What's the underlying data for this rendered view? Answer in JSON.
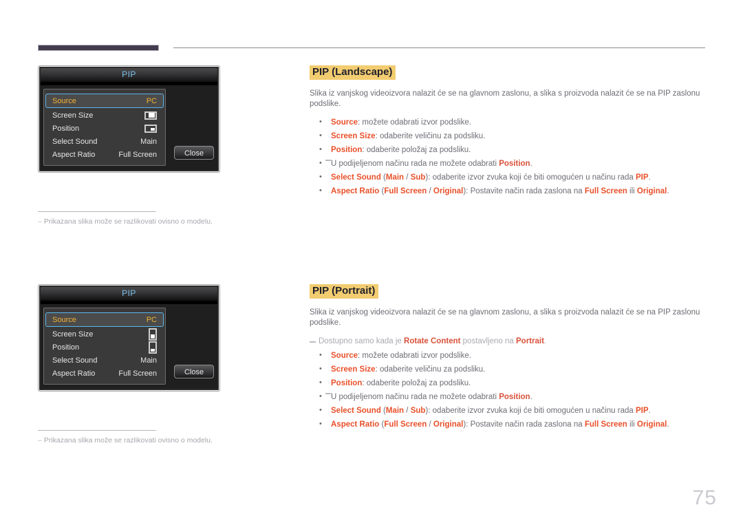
{
  "page": {
    "number": "75"
  },
  "sections": [
    {
      "id": "landscape",
      "heading": "PIP (Landscape)",
      "intro": "Slika iz vanjskog videoizvora nalazit će se na glavnom zaslonu, a slika s proizvoda nalazit će se na PIP zaslonu podslike.",
      "figure": {
        "title": "PIP",
        "close_label": "Close",
        "rows": [
          {
            "label": "Source",
            "value": "PC",
            "type": "text",
            "selected": true
          },
          {
            "label": "Screen Size",
            "value": "",
            "type": "icon-size-landscape",
            "icon_name": "screen-size-landscape-icon",
            "selected": false
          },
          {
            "label": "Position",
            "value": "",
            "type": "icon-position-landscape",
            "icon_name": "position-landscape-icon",
            "selected": false
          },
          {
            "label": "Select Sound",
            "value": "Main",
            "type": "text",
            "selected": false
          },
          {
            "label": "Aspect Ratio",
            "value": "Full Screen",
            "type": "text",
            "selected": false
          }
        ]
      },
      "figure_note": "Prikazana slika može se razlikovati ovisno o modelu.",
      "items": [
        {
          "kind": "bullet",
          "term": "Source",
          "rest": ": možete odabrati izvor podslike."
        },
        {
          "kind": "bullet",
          "term": "Screen Size",
          "rest": ": odaberite veličinu za podsliku."
        },
        {
          "kind": "bullet",
          "term": "Position",
          "rest": ": odaberite položaj za podsliku."
        },
        {
          "kind": "note",
          "pre": "U podijeljenom načinu rada ne možete odabrati ",
          "term": "Position",
          "post": "."
        },
        {
          "kind": "bullet-complex",
          "term": "Select Sound",
          "paren_open": " (",
          "paren_terms": [
            "Main",
            "Sub"
          ],
          "paren_sep": " / ",
          "paren_close": ")",
          "rest": ": odaberite izvor zvuka koji će biti omogućen u načinu rada ",
          "tail_term": "PIP",
          "tail": "."
        },
        {
          "kind": "bullet-complex",
          "term": "Aspect Ratio",
          "paren_open": " (",
          "paren_terms": [
            "Full Screen",
            "Original"
          ],
          "paren_sep": " / ",
          "paren_close": ")",
          "rest": ": Postavite način rada zaslona na ",
          "tail_term": "Full Screen",
          "tail_mid": " ili ",
          "tail_term2": "Original",
          "tail": "."
        }
      ]
    },
    {
      "id": "portrait",
      "heading": "PIP (Portrait)",
      "intro": "Slika iz vanjskog videoizvora nalazit će se na glavnom zaslonu, a slika s proizvoda nalazit će se na PIP zaslonu podslike.",
      "lead_note": {
        "pre": "Dostupno samo kada je ",
        "term": "Rotate Content",
        "mid": " postavljeno na ",
        "term2": "Portrait",
        "post": "."
      },
      "figure": {
        "title": "PIP",
        "close_label": "Close",
        "rows": [
          {
            "label": "Source",
            "value": "PC",
            "type": "text",
            "selected": true
          },
          {
            "label": "Screen Size",
            "value": "",
            "type": "icon-size-portrait",
            "icon_name": "screen-size-portrait-icon",
            "selected": false
          },
          {
            "label": "Position",
            "value": "",
            "type": "icon-position-portrait",
            "icon_name": "position-portrait-icon",
            "selected": false
          },
          {
            "label": "Select Sound",
            "value": "Main",
            "type": "text",
            "selected": false
          },
          {
            "label": "Aspect Ratio",
            "value": "Full Screen",
            "type": "text",
            "selected": false
          }
        ]
      },
      "figure_note": "Prikazana slika može se razlikovati ovisno o modelu.",
      "items": [
        {
          "kind": "bullet",
          "term": "Source",
          "rest": ": možete odabrati izvor podslike."
        },
        {
          "kind": "bullet",
          "term": "Screen Size",
          "rest": ": odaberite veličinu za podsliku."
        },
        {
          "kind": "bullet",
          "term": "Position",
          "rest": ": odaberite položaj za podsliku."
        },
        {
          "kind": "note",
          "pre": "U podijeljenom načinu rada ne možete odabrati ",
          "term": "Position",
          "post": "."
        },
        {
          "kind": "bullet-complex",
          "term": "Select Sound",
          "paren_open": " (",
          "paren_terms": [
            "Main",
            "Sub"
          ],
          "paren_sep": " / ",
          "paren_close": ")",
          "rest": ": odaberite izvor zvuka koji će biti omogućen u načinu rada ",
          "tail_term": "PIP",
          "tail": "."
        },
        {
          "kind": "bullet-complex",
          "term": "Aspect Ratio",
          "paren_open": " (",
          "paren_terms": [
            "Full Screen",
            "Original"
          ],
          "paren_sep": " / ",
          "paren_close": ")",
          "rest": ": Postavite način rada zaslona na ",
          "tail_term": "Full Screen",
          "tail_mid": " ili ",
          "tail_term2": "Original",
          "tail": "."
        }
      ]
    }
  ],
  "colors": {
    "heading_highlight": "#f2cc70",
    "keyword": "#e8502a",
    "body_text": "#6d6d75",
    "note_text": "#a9a9b1",
    "osd_title": "#7ec2ef",
    "osd_selected_text": "#f2b134",
    "osd_selected_border": "#59b7ef",
    "header_bar": "#443c4e",
    "page_number": "#c9c9cf"
  }
}
